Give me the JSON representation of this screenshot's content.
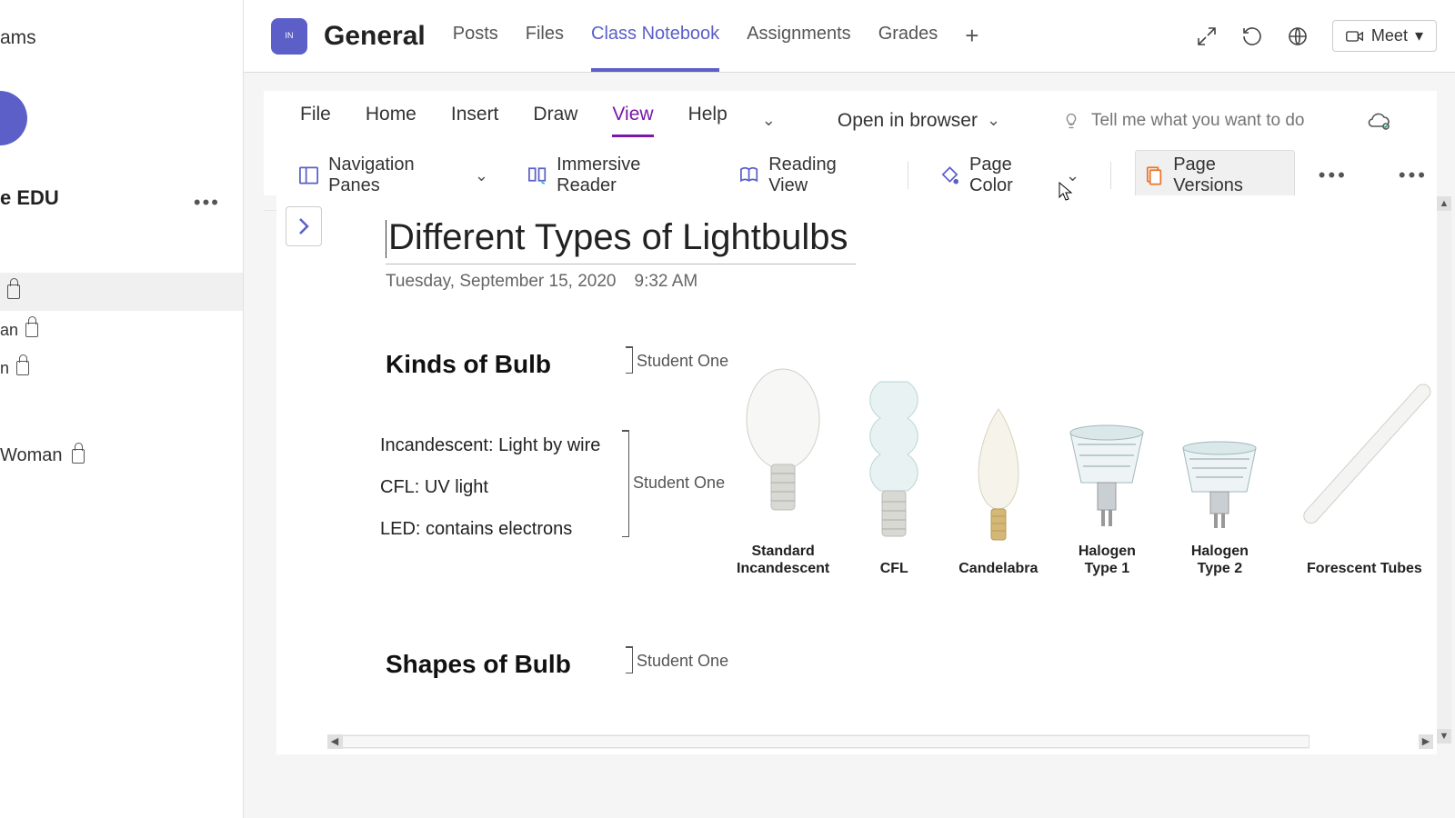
{
  "sidebar": {
    "app_label_cut": "ams",
    "team_label_cut": "e EDU",
    "items": [
      {
        "label_cut": "",
        "locked": true,
        "selected": true
      },
      {
        "label_cut": "an",
        "locked": true
      },
      {
        "label_cut": "n",
        "locked": true
      }
    ],
    "woman_label_cut": "Woman"
  },
  "header": {
    "channel": "General",
    "tabs": [
      {
        "label": "Posts"
      },
      {
        "label": "Files"
      },
      {
        "label": "Class Notebook",
        "active": true
      },
      {
        "label": "Assignments"
      },
      {
        "label": "Grades"
      }
    ],
    "meet_label": "Meet"
  },
  "ribbon": {
    "tabs": [
      {
        "label": "File"
      },
      {
        "label": "Home"
      },
      {
        "label": "Insert"
      },
      {
        "label": "Draw"
      },
      {
        "label": "View",
        "active": true
      },
      {
        "label": "Help"
      }
    ],
    "open_in_browser": "Open in browser",
    "tell_me_placeholder": "Tell me what you want to do",
    "tools": {
      "nav_panes": "Navigation Panes",
      "immersive": "Immersive Reader",
      "reading": "Reading View",
      "page_color": "Page Color",
      "page_versions": "Page Versions"
    }
  },
  "page": {
    "title": "Different Types of Lightbulbs",
    "date": "Tuesday, September 15, 2020",
    "time": "9:32 AM",
    "h_kinds": "Kinds of Bulb",
    "h_shapes": "Shapes of Bulb",
    "author1": "Student One",
    "author2": "Student One",
    "author3": "Student One",
    "line1": "Incandescent: Light by wire",
    "line2": "CFL: UV light",
    "line3": "LED: contains electrons",
    "bulbs": [
      {
        "label": "Standard Incandescent"
      },
      {
        "label": "CFL"
      },
      {
        "label": "Candelabra"
      },
      {
        "label": "Halogen Type 1"
      },
      {
        "label": "Halogen Type 2"
      },
      {
        "label": "Forescent Tubes"
      }
    ]
  }
}
